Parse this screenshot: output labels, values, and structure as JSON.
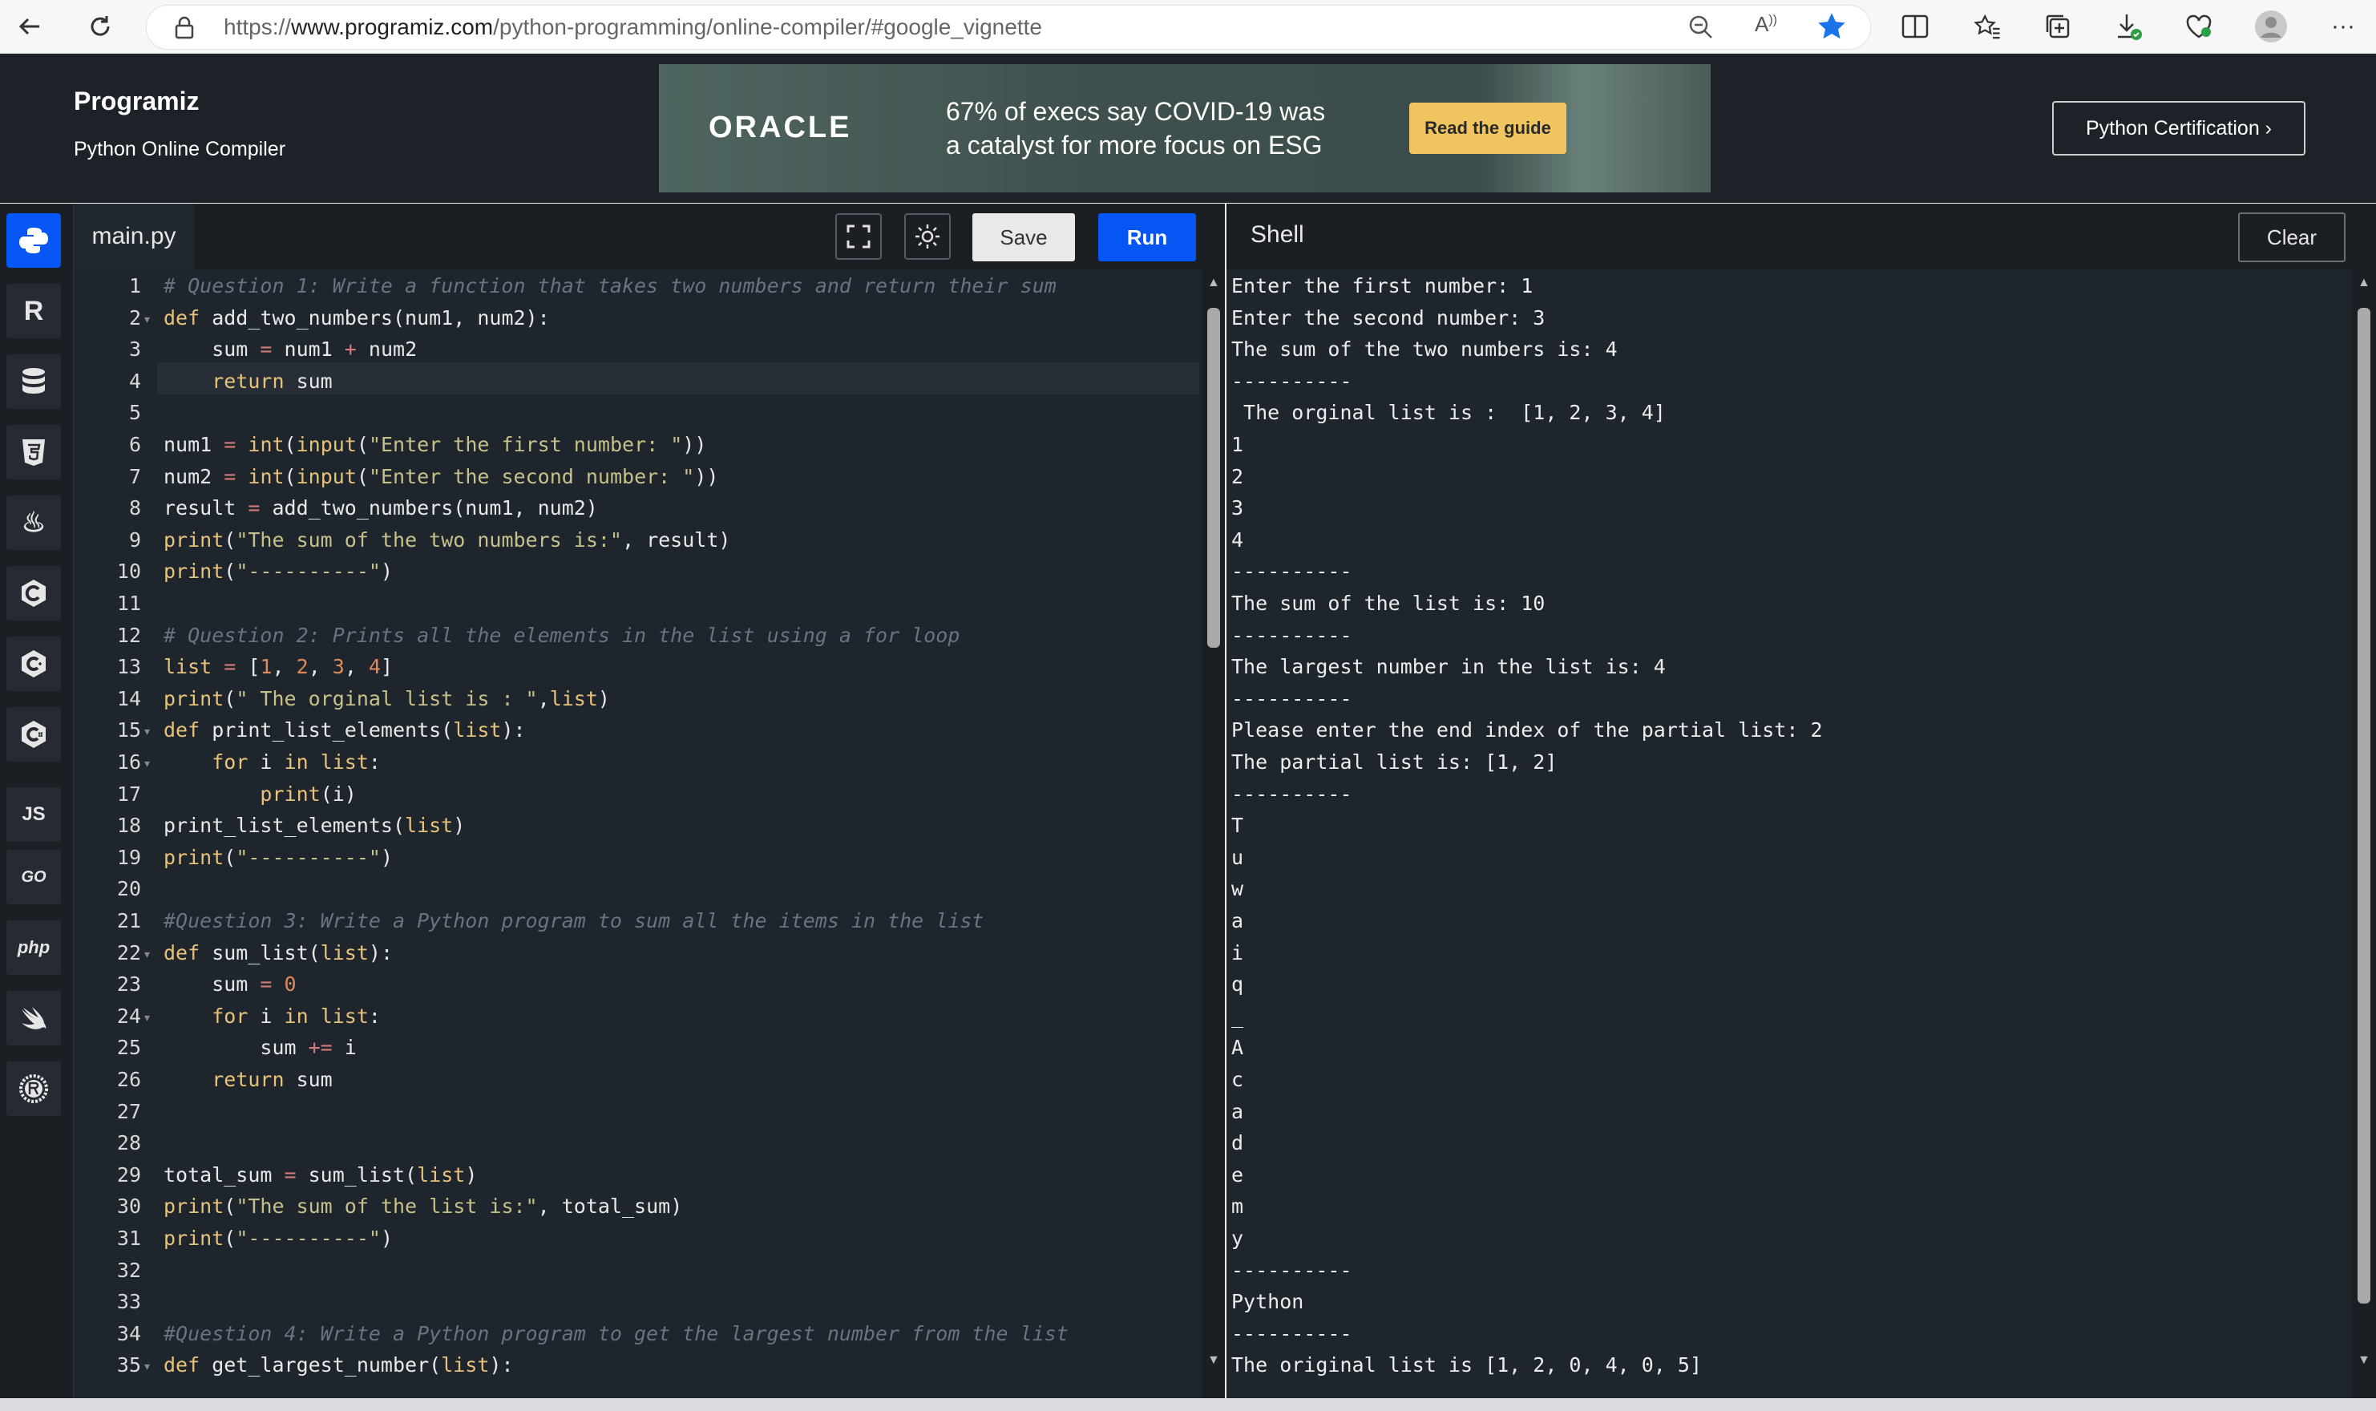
{
  "browser": {
    "url_prefix": "https://",
    "url_domain": "www.programiz.com",
    "url_path": "/python-programming/online-compiler/#google_vignette",
    "icons": [
      "back-icon",
      "refresh-icon",
      "lock-icon",
      "zoom-icon",
      "read-aloud-icon",
      "favorite-star-icon",
      "split-screen-icon",
      "favorites-icon",
      "collections-icon",
      "downloads-icon",
      "browser-essentials-icon",
      "profile-icon",
      "more-icon"
    ]
  },
  "header": {
    "logo": "Programiz",
    "subtitle": "Python Online Compiler",
    "certification_button": "Python Certification ›"
  },
  "ad": {
    "brand": "ORACLE",
    "text_line1": "67% of execs say COVID-19 was",
    "text_line2": "a catalyst for more focus on ESG",
    "cta": "Read the guide"
  },
  "sidebar": {
    "languages": [
      "python",
      "r",
      "sql",
      "html",
      "java",
      "c",
      "cpp",
      "csharp",
      "JS",
      "GO",
      "php",
      "swift",
      "rust"
    ],
    "js_label": "JS",
    "go_label": "GO",
    "php_label": "php"
  },
  "editor": {
    "file_tab": "main.py",
    "save_label": "Save",
    "run_label": "Run",
    "line_numbers": [
      "1",
      "2",
      "3",
      "4",
      "5",
      "6",
      "7",
      "8",
      "9",
      "10",
      "11",
      "12",
      "13",
      "14",
      "15",
      "16",
      "17",
      "18",
      "19",
      "20",
      "21",
      "22",
      "23",
      "24",
      "25",
      "26",
      "27",
      "28",
      "29",
      "30",
      "31",
      "32",
      "33",
      "34",
      "35"
    ]
  },
  "code_lines": [
    "# Question 1: Write a function that takes two numbers and return their sum",
    "def add_two_numbers(num1, num2):",
    "    sum = num1 + num2",
    "    return sum",
    "",
    "num1 = int(input(\"Enter the first number: \"))",
    "num2 = int(input(\"Enter the second number: \"))",
    "result = add_two_numbers(num1, num2)",
    "print(\"The sum of the two numbers is:\", result)",
    "print(\"----------\")",
    "",
    "# Question 2: Prints all the elements in the list using a for loop",
    "list = [1, 2, 3, 4]",
    "print(\" The orginal list is : \",list)",
    "def print_list_elements(list):",
    "    for i in list:",
    "        print(i)",
    "print_list_elements(list)",
    "print(\"----------\")",
    "",
    "#Question 3: Write a Python program to sum all the items in the list",
    "def sum_list(list):",
    "    sum = 0",
    "    for i in list:",
    "        sum += i",
    "    return sum",
    "",
    "",
    "total_sum = sum_list(list)",
    "print(\"The sum of the list is:\", total_sum)",
    "print(\"----------\")",
    "",
    "",
    "#Question 4: Write a Python program to get the largest number from the list",
    "def get_largest_number(list):"
  ],
  "shell": {
    "title": "Shell",
    "clear_label": "Clear",
    "output": [
      "Enter the first number: 1",
      "Enter the second number: 3",
      "The sum of the two numbers is: 4",
      "----------",
      " The orginal list is :  [1, 2, 3, 4]",
      "1",
      "2",
      "3",
      "4",
      "----------",
      "The sum of the list is: 10",
      "----------",
      "The largest number in the list is: 4",
      "----------",
      "Please enter the end index of the partial list: 2",
      "The partial list is: [1, 2]",
      "----------",
      "T",
      "u",
      "w",
      "a",
      "i",
      "q",
      "_",
      "A",
      "c",
      "a",
      "d",
      "e",
      "m",
      "y",
      "----------",
      "Python",
      "----------",
      "The original list is [1, 2, 0, 4, 0, 5]"
    ]
  }
}
